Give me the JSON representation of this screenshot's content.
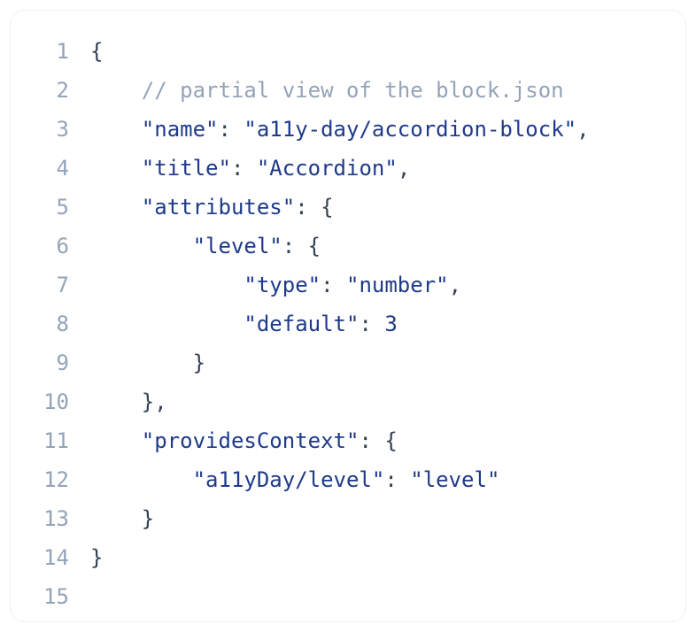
{
  "lines": [
    {
      "num": "1",
      "segments": [
        {
          "text": "{",
          "cls": "punctuation"
        }
      ]
    },
    {
      "num": "2",
      "segments": [
        {
          "text": "    ",
          "cls": "punctuation"
        },
        {
          "text": "// partial view of the block.json",
          "cls": "comment"
        }
      ]
    },
    {
      "num": "3",
      "segments": [
        {
          "text": "    ",
          "cls": "punctuation"
        },
        {
          "text": "\"name\"",
          "cls": "property"
        },
        {
          "text": ": ",
          "cls": "colon"
        },
        {
          "text": "\"a11y-day/accordion-block\"",
          "cls": "string"
        },
        {
          "text": ",",
          "cls": "punctuation"
        }
      ]
    },
    {
      "num": "4",
      "segments": [
        {
          "text": "    ",
          "cls": "punctuation"
        },
        {
          "text": "\"title\"",
          "cls": "property"
        },
        {
          "text": ": ",
          "cls": "colon"
        },
        {
          "text": "\"Accordion\"",
          "cls": "string"
        },
        {
          "text": ",",
          "cls": "punctuation"
        }
      ]
    },
    {
      "num": "5",
      "segments": [
        {
          "text": "    ",
          "cls": "punctuation"
        },
        {
          "text": "\"attributes\"",
          "cls": "property"
        },
        {
          "text": ": ",
          "cls": "colon"
        },
        {
          "text": "{",
          "cls": "punctuation"
        }
      ]
    },
    {
      "num": "6",
      "segments": [
        {
          "text": "        ",
          "cls": "punctuation"
        },
        {
          "text": "\"level\"",
          "cls": "property"
        },
        {
          "text": ": ",
          "cls": "colon"
        },
        {
          "text": "{",
          "cls": "punctuation"
        }
      ]
    },
    {
      "num": "7",
      "segments": [
        {
          "text": "            ",
          "cls": "punctuation"
        },
        {
          "text": "\"type\"",
          "cls": "property"
        },
        {
          "text": ": ",
          "cls": "colon"
        },
        {
          "text": "\"number\"",
          "cls": "string"
        },
        {
          "text": ",",
          "cls": "punctuation"
        }
      ]
    },
    {
      "num": "8",
      "segments": [
        {
          "text": "            ",
          "cls": "punctuation"
        },
        {
          "text": "\"default\"",
          "cls": "property"
        },
        {
          "text": ": ",
          "cls": "colon"
        },
        {
          "text": "3",
          "cls": "number"
        }
      ]
    },
    {
      "num": "9",
      "segments": [
        {
          "text": "        }",
          "cls": "punctuation"
        }
      ]
    },
    {
      "num": "10",
      "segments": [
        {
          "text": "    },",
          "cls": "punctuation"
        }
      ]
    },
    {
      "num": "11",
      "segments": [
        {
          "text": "    ",
          "cls": "punctuation"
        },
        {
          "text": "\"providesContext\"",
          "cls": "property"
        },
        {
          "text": ": ",
          "cls": "colon"
        },
        {
          "text": "{",
          "cls": "punctuation"
        }
      ]
    },
    {
      "num": "12",
      "segments": [
        {
          "text": "        ",
          "cls": "punctuation"
        },
        {
          "text": "\"a11yDay/level\"",
          "cls": "property"
        },
        {
          "text": ": ",
          "cls": "colon"
        },
        {
          "text": "\"level\"",
          "cls": "string"
        }
      ]
    },
    {
      "num": "13",
      "segments": [
        {
          "text": "    }",
          "cls": "punctuation"
        }
      ]
    },
    {
      "num": "14",
      "segments": [
        {
          "text": "}",
          "cls": "punctuation"
        }
      ]
    },
    {
      "num": "15",
      "segments": []
    }
  ]
}
